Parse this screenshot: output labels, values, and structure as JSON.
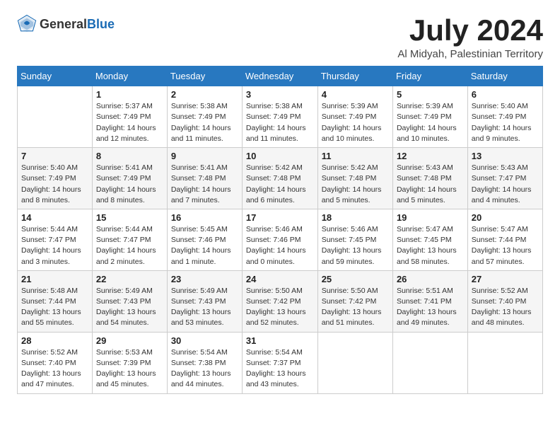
{
  "header": {
    "logo_general": "General",
    "logo_blue": "Blue",
    "title": "July 2024",
    "subtitle": "Al Midyah, Palestinian Territory"
  },
  "calendar": {
    "days_of_week": [
      "Sunday",
      "Monday",
      "Tuesday",
      "Wednesday",
      "Thursday",
      "Friday",
      "Saturday"
    ],
    "weeks": [
      [
        {
          "day": "",
          "info": ""
        },
        {
          "day": "1",
          "info": "Sunrise: 5:37 AM\nSunset: 7:49 PM\nDaylight: 14 hours and 12 minutes."
        },
        {
          "day": "2",
          "info": "Sunrise: 5:38 AM\nSunset: 7:49 PM\nDaylight: 14 hours and 11 minutes."
        },
        {
          "day": "3",
          "info": "Sunrise: 5:38 AM\nSunset: 7:49 PM\nDaylight: 14 hours and 11 minutes."
        },
        {
          "day": "4",
          "info": "Sunrise: 5:39 AM\nSunset: 7:49 PM\nDaylight: 14 hours and 10 minutes."
        },
        {
          "day": "5",
          "info": "Sunrise: 5:39 AM\nSunset: 7:49 PM\nDaylight: 14 hours and 10 minutes."
        },
        {
          "day": "6",
          "info": "Sunrise: 5:40 AM\nSunset: 7:49 PM\nDaylight: 14 hours and 9 minutes."
        }
      ],
      [
        {
          "day": "7",
          "info": "Sunrise: 5:40 AM\nSunset: 7:49 PM\nDaylight: 14 hours and 8 minutes."
        },
        {
          "day": "8",
          "info": "Sunrise: 5:41 AM\nSunset: 7:49 PM\nDaylight: 14 hours and 8 minutes."
        },
        {
          "day": "9",
          "info": "Sunrise: 5:41 AM\nSunset: 7:48 PM\nDaylight: 14 hours and 7 minutes."
        },
        {
          "day": "10",
          "info": "Sunrise: 5:42 AM\nSunset: 7:48 PM\nDaylight: 14 hours and 6 minutes."
        },
        {
          "day": "11",
          "info": "Sunrise: 5:42 AM\nSunset: 7:48 PM\nDaylight: 14 hours and 5 minutes."
        },
        {
          "day": "12",
          "info": "Sunrise: 5:43 AM\nSunset: 7:48 PM\nDaylight: 14 hours and 5 minutes."
        },
        {
          "day": "13",
          "info": "Sunrise: 5:43 AM\nSunset: 7:47 PM\nDaylight: 14 hours and 4 minutes."
        }
      ],
      [
        {
          "day": "14",
          "info": "Sunrise: 5:44 AM\nSunset: 7:47 PM\nDaylight: 14 hours and 3 minutes."
        },
        {
          "day": "15",
          "info": "Sunrise: 5:44 AM\nSunset: 7:47 PM\nDaylight: 14 hours and 2 minutes."
        },
        {
          "day": "16",
          "info": "Sunrise: 5:45 AM\nSunset: 7:46 PM\nDaylight: 14 hours and 1 minute."
        },
        {
          "day": "17",
          "info": "Sunrise: 5:46 AM\nSunset: 7:46 PM\nDaylight: 14 hours and 0 minutes."
        },
        {
          "day": "18",
          "info": "Sunrise: 5:46 AM\nSunset: 7:45 PM\nDaylight: 13 hours and 59 minutes."
        },
        {
          "day": "19",
          "info": "Sunrise: 5:47 AM\nSunset: 7:45 PM\nDaylight: 13 hours and 58 minutes."
        },
        {
          "day": "20",
          "info": "Sunrise: 5:47 AM\nSunset: 7:44 PM\nDaylight: 13 hours and 57 minutes."
        }
      ],
      [
        {
          "day": "21",
          "info": "Sunrise: 5:48 AM\nSunset: 7:44 PM\nDaylight: 13 hours and 55 minutes."
        },
        {
          "day": "22",
          "info": "Sunrise: 5:49 AM\nSunset: 7:43 PM\nDaylight: 13 hours and 54 minutes."
        },
        {
          "day": "23",
          "info": "Sunrise: 5:49 AM\nSunset: 7:43 PM\nDaylight: 13 hours and 53 minutes."
        },
        {
          "day": "24",
          "info": "Sunrise: 5:50 AM\nSunset: 7:42 PM\nDaylight: 13 hours and 52 minutes."
        },
        {
          "day": "25",
          "info": "Sunrise: 5:50 AM\nSunset: 7:42 PM\nDaylight: 13 hours and 51 minutes."
        },
        {
          "day": "26",
          "info": "Sunrise: 5:51 AM\nSunset: 7:41 PM\nDaylight: 13 hours and 49 minutes."
        },
        {
          "day": "27",
          "info": "Sunrise: 5:52 AM\nSunset: 7:40 PM\nDaylight: 13 hours and 48 minutes."
        }
      ],
      [
        {
          "day": "28",
          "info": "Sunrise: 5:52 AM\nSunset: 7:40 PM\nDaylight: 13 hours and 47 minutes."
        },
        {
          "day": "29",
          "info": "Sunrise: 5:53 AM\nSunset: 7:39 PM\nDaylight: 13 hours and 45 minutes."
        },
        {
          "day": "30",
          "info": "Sunrise: 5:54 AM\nSunset: 7:38 PM\nDaylight: 13 hours and 44 minutes."
        },
        {
          "day": "31",
          "info": "Sunrise: 5:54 AM\nSunset: 7:37 PM\nDaylight: 13 hours and 43 minutes."
        },
        {
          "day": "",
          "info": ""
        },
        {
          "day": "",
          "info": ""
        },
        {
          "day": "",
          "info": ""
        }
      ]
    ]
  }
}
